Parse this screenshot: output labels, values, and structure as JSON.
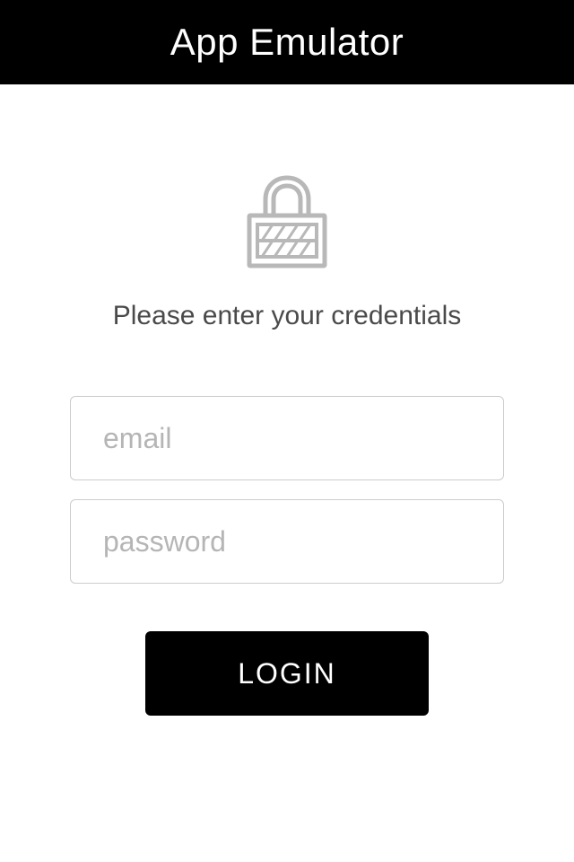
{
  "header": {
    "title": "App Emulator"
  },
  "login": {
    "instruction": "Please enter your credentials",
    "email_placeholder": "email",
    "email_value": "",
    "password_placeholder": "password",
    "password_value": "",
    "button_label": "LOGIN"
  },
  "icons": {
    "lock": "lock-icon"
  }
}
